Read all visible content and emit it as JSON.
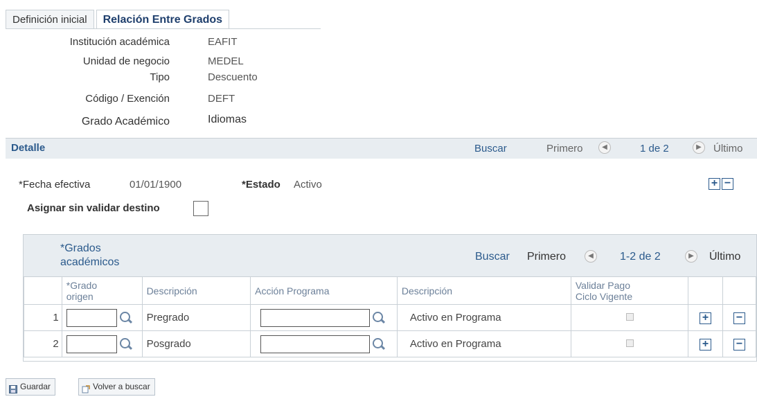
{
  "tabs": {
    "inactive": "Definición inicial",
    "active": "Relación Entre Grados"
  },
  "header": {
    "institucion_label": "Institución académica",
    "institucion_value": "EAFIT",
    "unidad_label": "Unidad de negocio",
    "unidad_value": "MEDEL",
    "tipo_label": "Tipo",
    "tipo_value": "Descuento",
    "codigo_label": "Código / Exención",
    "codigo_value": "DEFT",
    "grado_label": "Grado Académico",
    "grado_value": "Idiomas"
  },
  "detalle": {
    "title": "Detalle",
    "buscar": "Buscar",
    "primero": "Primero",
    "count": "1 de 2",
    "ultimo": "Último"
  },
  "form": {
    "fecha_label": "*Fecha efectiva",
    "fecha_value": "01/01/1900",
    "estado_label": "*Estado",
    "estado_value": "Activo",
    "asignar_label": "Asignar sin validar destino"
  },
  "grid": {
    "title_line1": "*Grados",
    "title_line2": "académicos",
    "buscar": "Buscar",
    "primero": "Primero",
    "count": "1-2 de 2",
    "ultimo": "Último",
    "columns": {
      "grado_origen_1": "*Grado",
      "grado_origen_2": "origen",
      "descripcion": "Descripción",
      "accion": "Acción Programa",
      "descripcion2": "Descripción",
      "validar_1": "Validar Pago",
      "validar_2": "Ciclo Vigente"
    },
    "rows": [
      {
        "num": "1",
        "descripcion": "Pregrado",
        "descripcion2": "Activo en Programa"
      },
      {
        "num": "2",
        "descripcion": "Posgrado",
        "descripcion2": "Activo en Programa"
      }
    ]
  },
  "buttons": {
    "guardar": "Guardar",
    "volver": "Volver a buscar"
  },
  "colors": {
    "link": "#2b5a8c",
    "bar": "#e8edf1",
    "border": "#c9d0d6"
  }
}
